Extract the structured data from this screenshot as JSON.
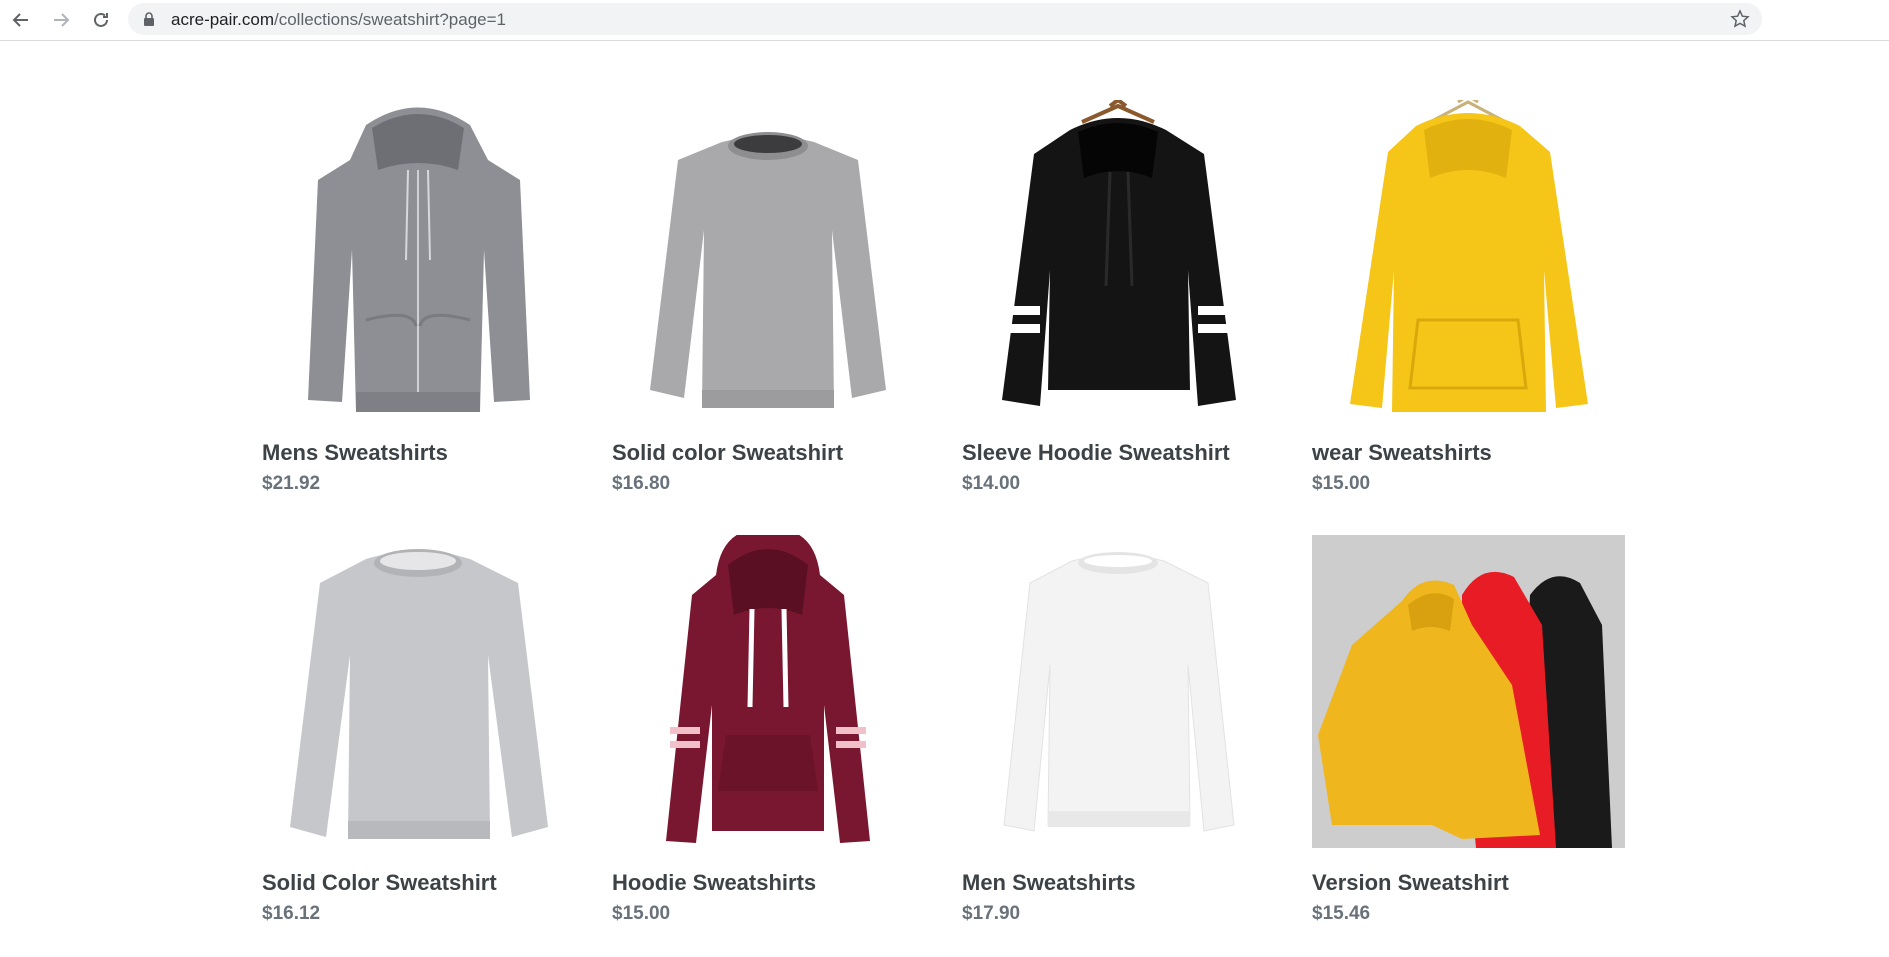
{
  "browser": {
    "url_host": "acre-pair.com",
    "url_path": "/collections/sweatshirt?page=1",
    "icons": [
      "back-arrow-icon",
      "forward-arrow-icon",
      "reload-icon",
      "lock-icon",
      "bookmark-star-icon"
    ]
  },
  "products": [
    {
      "title": "Mens Sweatshirts",
      "price": "$21.92",
      "image": "gray-zip-hoodie",
      "color": "#8e8f94"
    },
    {
      "title": "Solid color Sweatshirt",
      "price": "$16.80",
      "image": "gray-crewneck",
      "color": "#a9a9ab"
    },
    {
      "title": "Sleeve Hoodie Sweatshirt",
      "price": "$14.00",
      "image": "black-striped-hoodie",
      "color": "#141414"
    },
    {
      "title": "wear Sweatshirts",
      "price": "$15.00",
      "image": "yellow-hoodie",
      "color": "#f5c518"
    },
    {
      "title": "Solid Color Sweatshirt",
      "price": "$16.12",
      "image": "light-gray-crewneck",
      "color": "#c6c7cb"
    },
    {
      "title": "Hoodie Sweatshirts",
      "price": "$15.00",
      "image": "burgundy-hoodie",
      "color": "#7a1730"
    },
    {
      "title": "Men Sweatshirts",
      "price": "$17.90",
      "image": "white-crewneck",
      "color": "#f3f3f3"
    },
    {
      "title": "Version Sweatshirt",
      "price": "$15.46",
      "image": "three-hoodies-photo",
      "color": "#e9b51f"
    }
  ]
}
